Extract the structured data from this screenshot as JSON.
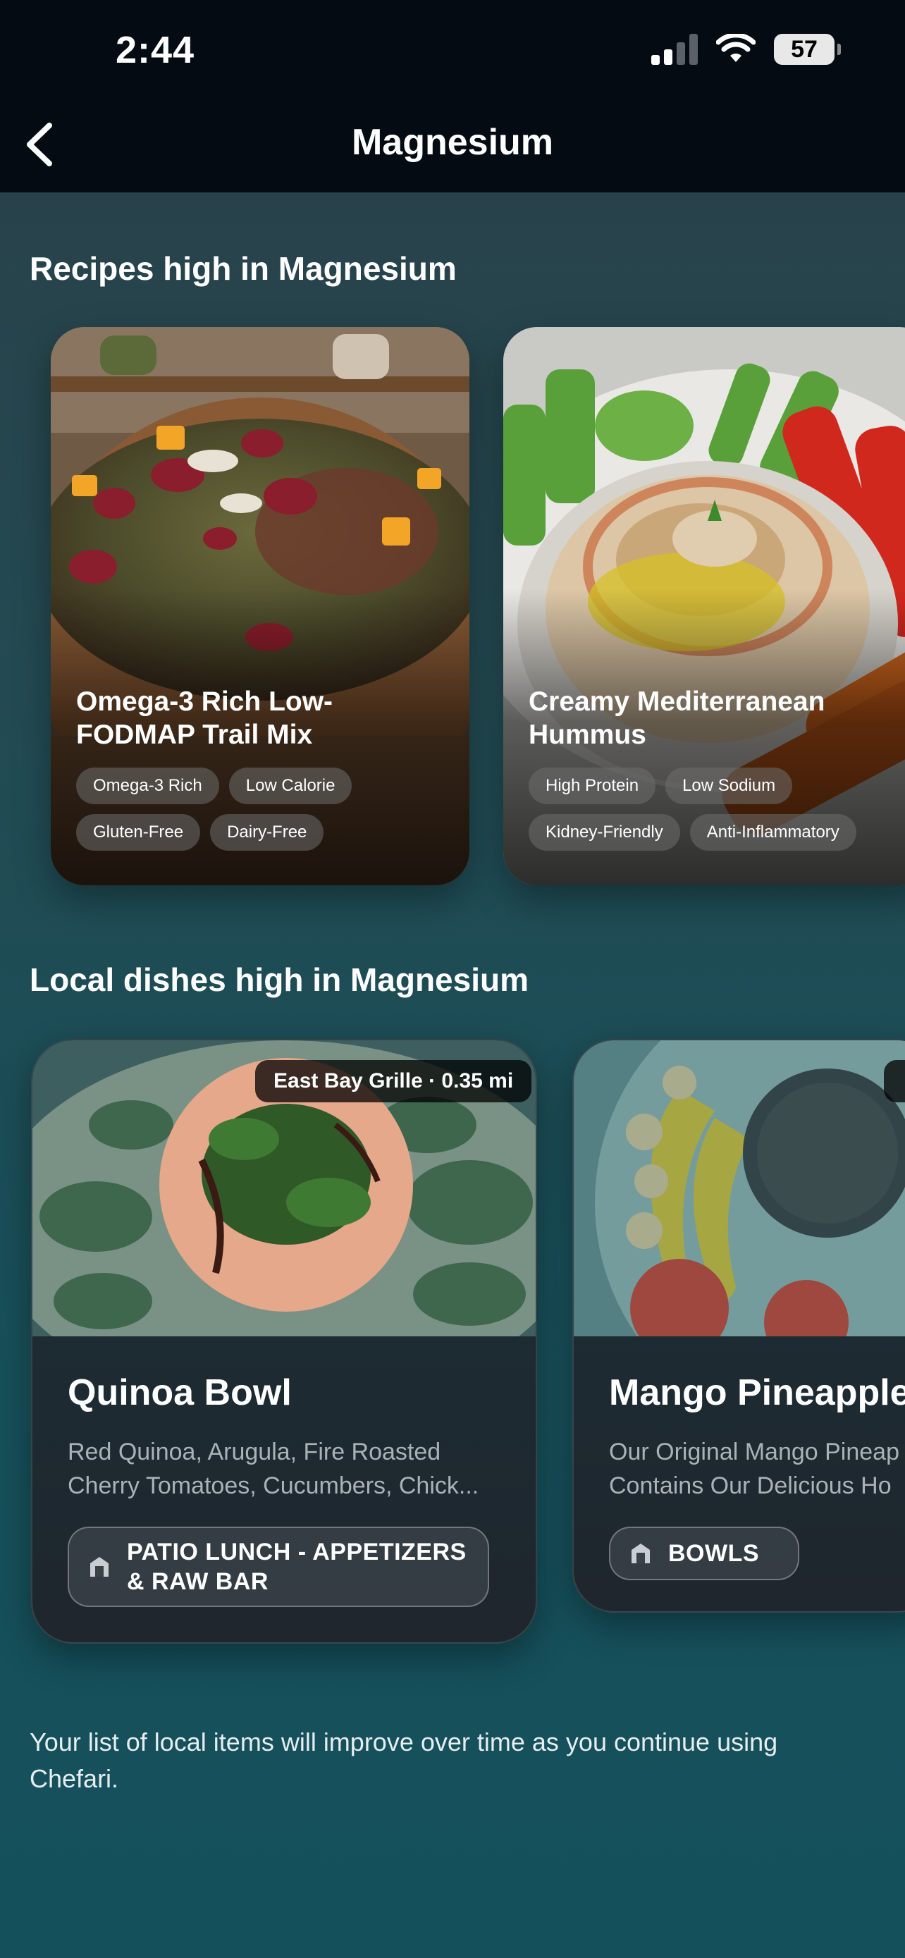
{
  "status": {
    "time": "2:44",
    "battery": "57"
  },
  "nav": {
    "title": "Magnesium",
    "back_icon": "chevron-left-icon"
  },
  "recipes_section": {
    "title": "Recipes high in Magnesium",
    "cards": [
      {
        "name": "Omega-3 Rich Low-FODMAP Trail Mix",
        "tags": [
          "Omega-3 Rich",
          "Low Calorie",
          "Gluten-Free",
          "Dairy-Free"
        ]
      },
      {
        "name": "Creamy Mediterranean Hummus",
        "tags": [
          "High Protein",
          "Low Sodium",
          "Kidney-Friendly",
          "Anti-Inflammatory"
        ]
      }
    ]
  },
  "local_section": {
    "title": "Local dishes high in Magnesium",
    "dishes": [
      {
        "restaurant_badge": "East Bay Grille · 0.35 mi",
        "name": "Quinoa Bowl",
        "desc_line1": "Red Quinoa, Arugula, Fire Roasted",
        "desc_line2": "Cherry Tomatoes, Cucumbers, Chick...",
        "menu_section": "PATIO LUNCH - APPETIZERS & RAW BAR",
        "menu_icon": "store-icon"
      },
      {
        "name": "Mango Pineapple",
        "desc_line1": "Our Original Mango Pineap",
        "desc_line2": "Contains Our Delicious Ho",
        "menu_section": "BOWLS",
        "menu_icon": "store-icon"
      }
    ]
  },
  "footer": {
    "note": "Your list of local items will improve over time as you continue using Chefari."
  },
  "colors": {
    "topbar": "#050b12",
    "chip_bg": "#6e6e6e",
    "dish_card": "#1d2a32"
  }
}
